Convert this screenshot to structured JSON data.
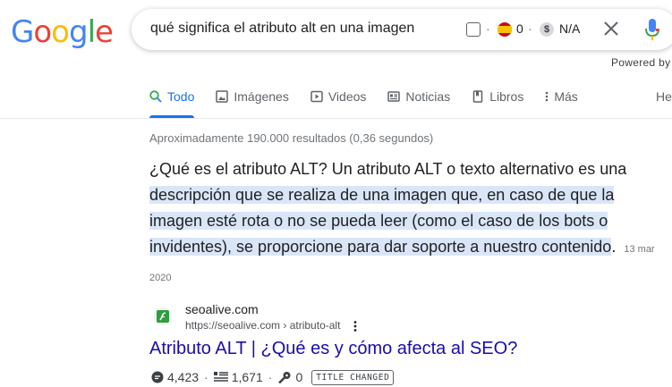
{
  "logo": {
    "letters": [
      "G",
      "o",
      "o",
      "g",
      "l",
      "e"
    ],
    "colors": [
      "#4285f4",
      "#ea4335",
      "#fbbc05",
      "#4285f4",
      "#34a853",
      "#ea4335"
    ]
  },
  "search": {
    "query": "qué significa el atributo alt en una imagen",
    "flag_value": "0",
    "coin_symbol": "$",
    "coin_value": "N/A",
    "separator": "·"
  },
  "powered_by": "Powered by",
  "tabs": [
    {
      "label": "Todo",
      "icon": "search-icon",
      "active": true
    },
    {
      "label": "Imágenes",
      "icon": "image-icon",
      "active": false
    },
    {
      "label": "Videos",
      "icon": "video-icon",
      "active": false
    },
    {
      "label": "Noticias",
      "icon": "news-icon",
      "active": false
    },
    {
      "label": "Libros",
      "icon": "book-icon",
      "active": false
    },
    {
      "label": "Más",
      "icon": "more-vert-icon",
      "active": false
    }
  ],
  "tab_extra": "He",
  "stats": "Aproximadamente 190.000 resultados (0,36 segundos)",
  "featured_snippet": {
    "lead": "¿Qué es el atributo ALT? Un atributo ALT o texto alternativo es una ",
    "highlight": "descripción que se realiza de una imagen que, en caso de que la imagen esté rota o no se pueda leer (como el caso de los bots o invidentes), se proporcione para dar soporte a nuestro contenido",
    "tail": ".",
    "date": "13 mar 2020"
  },
  "result": {
    "site_name": "seoalive.com",
    "url": "https://seoalive.com › atributo-alt",
    "title": "Atributo ALT | ¿Qué es y cómo afecta al SEO?"
  },
  "metrics": {
    "m1": "4,423",
    "m2": "1,671",
    "m3": "0",
    "badge": "TITLE CHANGED",
    "separator": "·"
  },
  "colors": {
    "accent": "#1a73e8",
    "link": "#1a0dab",
    "highlight": "#dae6f8"
  }
}
